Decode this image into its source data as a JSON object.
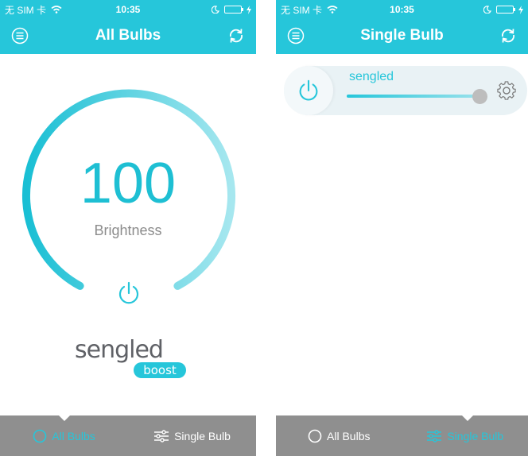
{
  "left": {
    "status": {
      "carrier": "无 SIM 卡",
      "time": "10:35"
    },
    "nav": {
      "title": "All Bulbs"
    },
    "dial": {
      "value": "100",
      "label": "Brightness",
      "level": 1.0
    },
    "logo": {
      "word": "sengled",
      "tag": "boost"
    },
    "tabs": [
      {
        "label": "All Bulbs",
        "active": true
      },
      {
        "label": "Single Bulb",
        "active": false
      }
    ]
  },
  "right": {
    "status": {
      "carrier": "无 SIM 卡",
      "time": "10:35"
    },
    "nav": {
      "title": "Single Bulb"
    },
    "bulb": {
      "name": "sengled",
      "brightness_level": 0.95
    },
    "tabs": [
      {
        "label": "All Bulbs",
        "active": false
      },
      {
        "label": "Single Bulb",
        "active": true
      }
    ]
  },
  "colors": {
    "accent": "#26c6da",
    "accent_light": "#a6e7ef",
    "tabbar": "#8f8f8f",
    "label_gray": "#8c8c8c"
  },
  "icons": [
    "menu-icon",
    "refresh-icon",
    "power-icon",
    "gear-icon",
    "bulb-icon",
    "sliders-icon",
    "wifi-icon",
    "moon-icon",
    "battery-icon",
    "charging-icon"
  ]
}
